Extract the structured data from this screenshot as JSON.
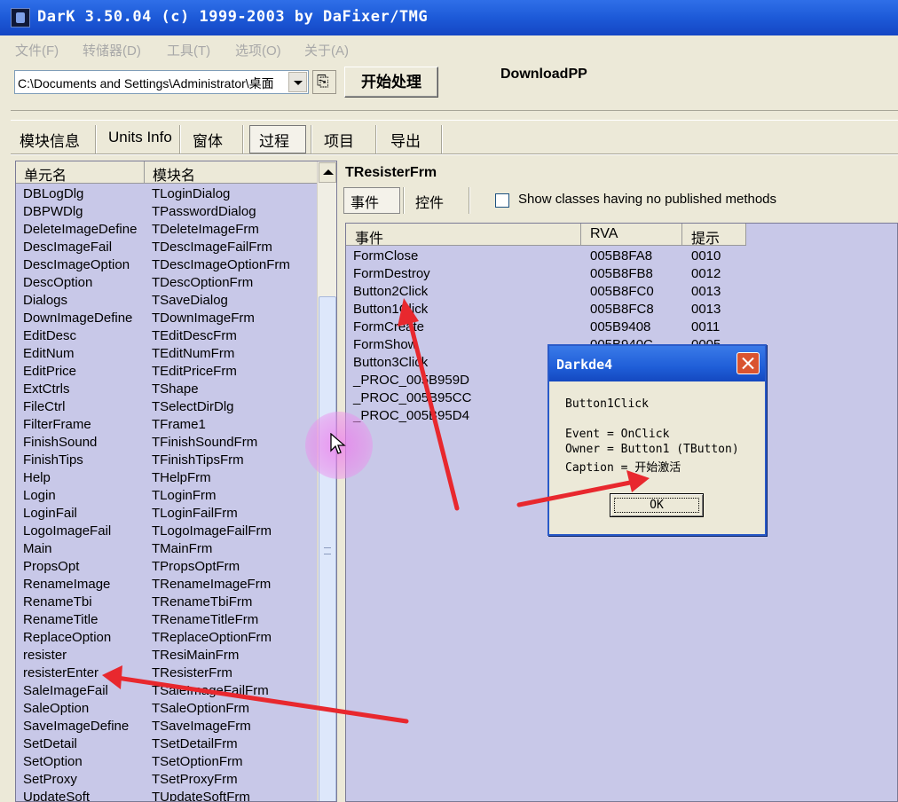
{
  "window": {
    "title": "DarK 3.50.04 (c) 1999-2003 by DaFixer/TMG"
  },
  "menu": [
    "文件(F)",
    "转储器(D)",
    "工具(T)",
    "选项(O)",
    "关于(A)"
  ],
  "toolbar": {
    "path_value": "C:\\Documents and Settings\\Administrator\\桌面",
    "start_label": "开始处理",
    "project_label": "DownloadPP"
  },
  "main_tabs": [
    "模块信息",
    "Units Info",
    "窗体",
    "过程",
    "项目",
    "导出"
  ],
  "main_tab_active": "过程",
  "unit_list": {
    "headers": [
      "单元名",
      "模块名"
    ],
    "rows": [
      [
        "DBLogDlg",
        "TLoginDialog"
      ],
      [
        "DBPWDlg",
        "TPasswordDialog"
      ],
      [
        "DeleteImageDefine",
        "TDeleteImageFrm"
      ],
      [
        "DescImageFail",
        "TDescImageFailFrm"
      ],
      [
        "DescImageOption",
        "TDescImageOptionFrm"
      ],
      [
        "DescOption",
        "TDescOptionFrm"
      ],
      [
        "Dialogs",
        "TSaveDialog"
      ],
      [
        "DownImageDefine",
        "TDownImageFrm"
      ],
      [
        "EditDesc",
        "TEditDescFrm"
      ],
      [
        "EditNum",
        "TEditNumFrm"
      ],
      [
        "EditPrice",
        "TEditPriceFrm"
      ],
      [
        "ExtCtrls",
        "TShape"
      ],
      [
        "FileCtrl",
        "TSelectDirDlg"
      ],
      [
        "FilterFrame",
        "TFrame1"
      ],
      [
        "FinishSound",
        "TFinishSoundFrm"
      ],
      [
        "FinishTips",
        "TFinishTipsFrm"
      ],
      [
        "Help",
        "THelpFrm"
      ],
      [
        "Login",
        "TLoginFrm"
      ],
      [
        "LoginFail",
        "TLoginFailFrm"
      ],
      [
        "LogoImageFail",
        "TLogoImageFailFrm"
      ],
      [
        "Main",
        "TMainFrm"
      ],
      [
        "PropsOpt",
        "TPropsOptFrm"
      ],
      [
        "RenameImage",
        "TRenameImageFrm"
      ],
      [
        "RenameTbi",
        "TRenameTbiFrm"
      ],
      [
        "RenameTitle",
        "TRenameTitleFrm"
      ],
      [
        "ReplaceOption",
        "TReplaceOptionFrm"
      ],
      [
        "resister",
        "TResiMainFrm"
      ],
      [
        "resisterEnter",
        "TResisterFrm"
      ],
      [
        "SaleImageFail",
        "TSaleImageFailFrm"
      ],
      [
        "SaleOption",
        "TSaleOptionFrm"
      ],
      [
        "SaveImageDefine",
        "TSaveImageFrm"
      ],
      [
        "SetDetail",
        "TSetDetailFrm"
      ],
      [
        "SetOption",
        "TSetOptionFrm"
      ],
      [
        "SetProxy",
        "TSetProxyFrm"
      ],
      [
        "UpdateSoft",
        "TUpdateSoftFrm"
      ]
    ]
  },
  "form_panel": {
    "title": "TResisterFrm",
    "subtabs": [
      "事件",
      "控件"
    ],
    "checkbox_label": "Show classes having no published methods",
    "headers": [
      "事件",
      "RVA",
      "提示"
    ],
    "rows": [
      [
        "FormClose",
        "005B8FA8",
        "0010"
      ],
      [
        "FormDestroy",
        "005B8FB8",
        "0012"
      ],
      [
        "Button2Click",
        "005B8FC0",
        "0013"
      ],
      [
        "Button1Click",
        "005B8FC8",
        "0013"
      ],
      [
        "FormCreate",
        "005B9408",
        "0011"
      ],
      [
        "FormShow",
        "005B940C",
        "0005"
      ],
      [
        "Button3Click",
        "",
        ""
      ],
      [
        "_PROC_005B959D",
        "",
        ""
      ],
      [
        "_PROC_005B95CC",
        "",
        ""
      ],
      [
        "_PROC_005B95D4",
        "",
        ""
      ]
    ]
  },
  "dialog": {
    "title": "Darkde4",
    "method": "Button1Click",
    "event_line": "Event = OnClick",
    "owner_line": "Owner = Button1 (TButton)",
    "caption_line": "Caption = 开始激活",
    "ok_label": "OK"
  },
  "colors": {
    "titlebar": "#1d5ad8",
    "list_bg": "#c8c8e8",
    "window_bg": "#ece9d8",
    "annotation_arrow": "#e8282e",
    "cursor_highlight": "#ec78ec"
  }
}
